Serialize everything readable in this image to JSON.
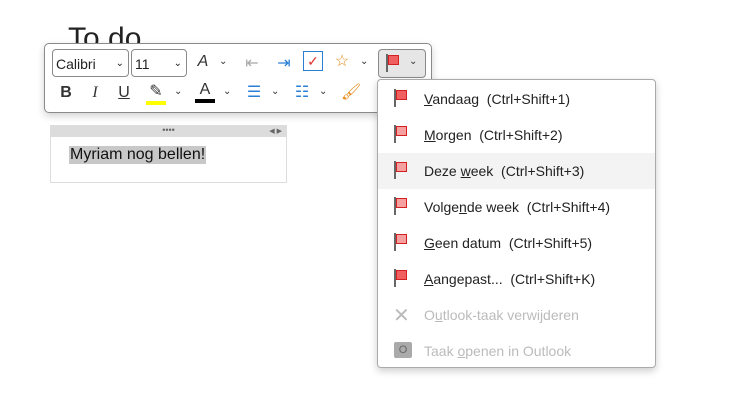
{
  "page": {
    "title": "To do"
  },
  "toolbar": {
    "font": "Calibri",
    "size": "11"
  },
  "note": {
    "text": "Myriam nog bellen!",
    "handle": "••••",
    "arrows": "◀ ▶"
  },
  "menu": {
    "items": [
      {
        "pre": "",
        "acc": "V",
        "post": "andaag  (Ctrl+Shift+1)"
      },
      {
        "pre": "",
        "acc": "M",
        "post": "orgen  (Ctrl+Shift+2)"
      },
      {
        "pre": "Deze ",
        "acc": "w",
        "post": "eek  (Ctrl+Shift+3)"
      },
      {
        "pre": "Volge",
        "acc": "n",
        "post": "de week  (Ctrl+Shift+4)"
      },
      {
        "pre": "",
        "acc": "G",
        "post": "een datum  (Ctrl+Shift+5)"
      },
      {
        "pre": "",
        "acc": "A",
        "post": "angepast...  (Ctrl+Shift+K)"
      },
      {
        "pre": "O",
        "acc": "u",
        "post": "tlook-taak verwijderen"
      },
      {
        "pre": "Taak ",
        "acc": "o",
        "post": "penen in Outlook"
      }
    ]
  },
  "colors": {
    "highlight": "#ffff00",
    "fontcolor": "#000000",
    "flag": "#d42020"
  }
}
